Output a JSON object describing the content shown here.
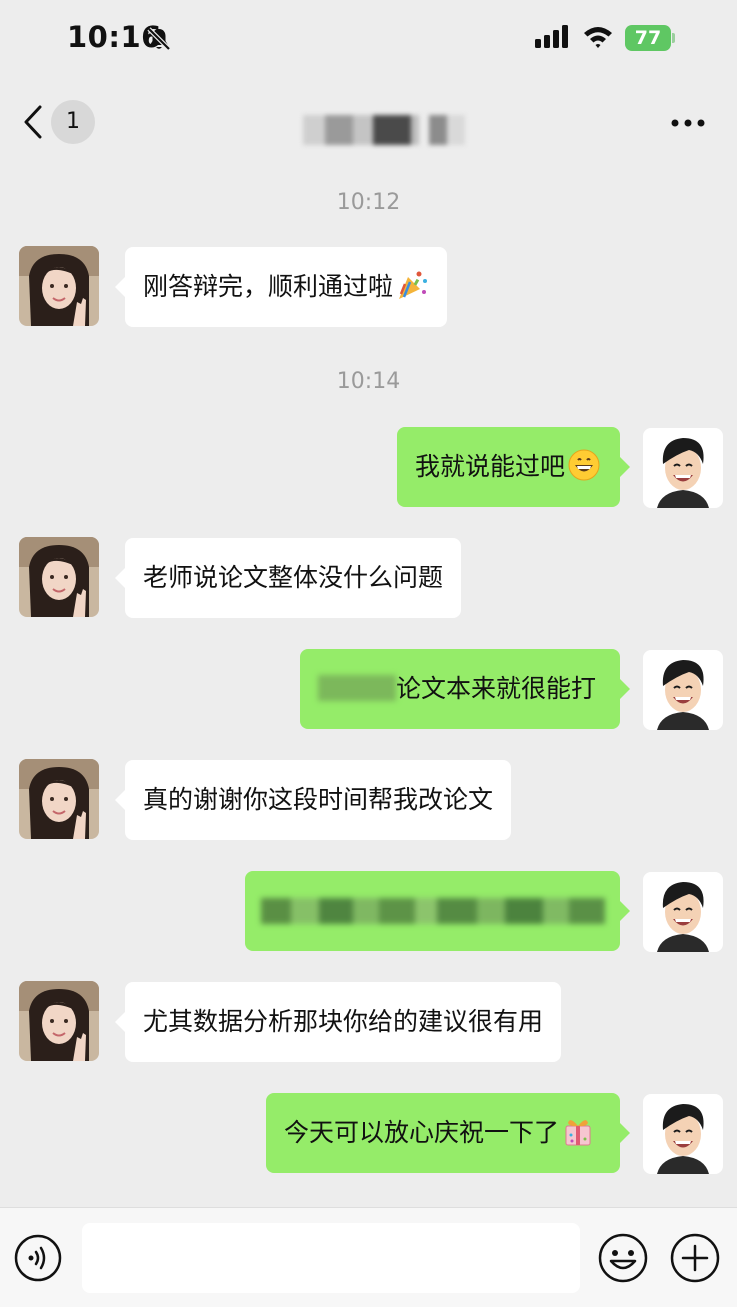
{
  "status_bar": {
    "time": "10:16",
    "battery": "77"
  },
  "nav": {
    "unread_count": "1",
    "title": "",
    "back_icon": "chevron-left-icon",
    "more_icon": "more-dots-icon"
  },
  "timestamps": [
    "10:12",
    "10:14"
  ],
  "messages": [
    {
      "side": "left",
      "text": "刚答辩完，顺利通过啦",
      "emoji": "party-popper-icon"
    },
    {
      "side": "right",
      "text": "我就说能过吧",
      "emoji": "grinning-face-icon"
    },
    {
      "side": "left",
      "text": "老师说论文整体没什么问题"
    },
    {
      "side": "right",
      "text": "论文本来就很能打",
      "note": "prefix blurred"
    },
    {
      "side": "left",
      "text": "真的谢谢你这段时间帮我改论文"
    },
    {
      "side": "right",
      "text": "",
      "note": "fully blurred"
    },
    {
      "side": "left",
      "text": "尤其数据分析那块你给的建议很有用"
    },
    {
      "side": "right",
      "text": "今天可以放心庆祝一下了",
      "emoji": "gift-icon"
    }
  ],
  "input_bar": {
    "voice_icon": "voice-icon",
    "emoji_icon": "emoji-face-icon",
    "plus_icon": "plus-circle-icon",
    "placeholder": ""
  },
  "colors": {
    "background": "#ededed",
    "self_bubble": "#95ec69",
    "other_bubble": "#ffffff",
    "battery": "#5fc763"
  }
}
